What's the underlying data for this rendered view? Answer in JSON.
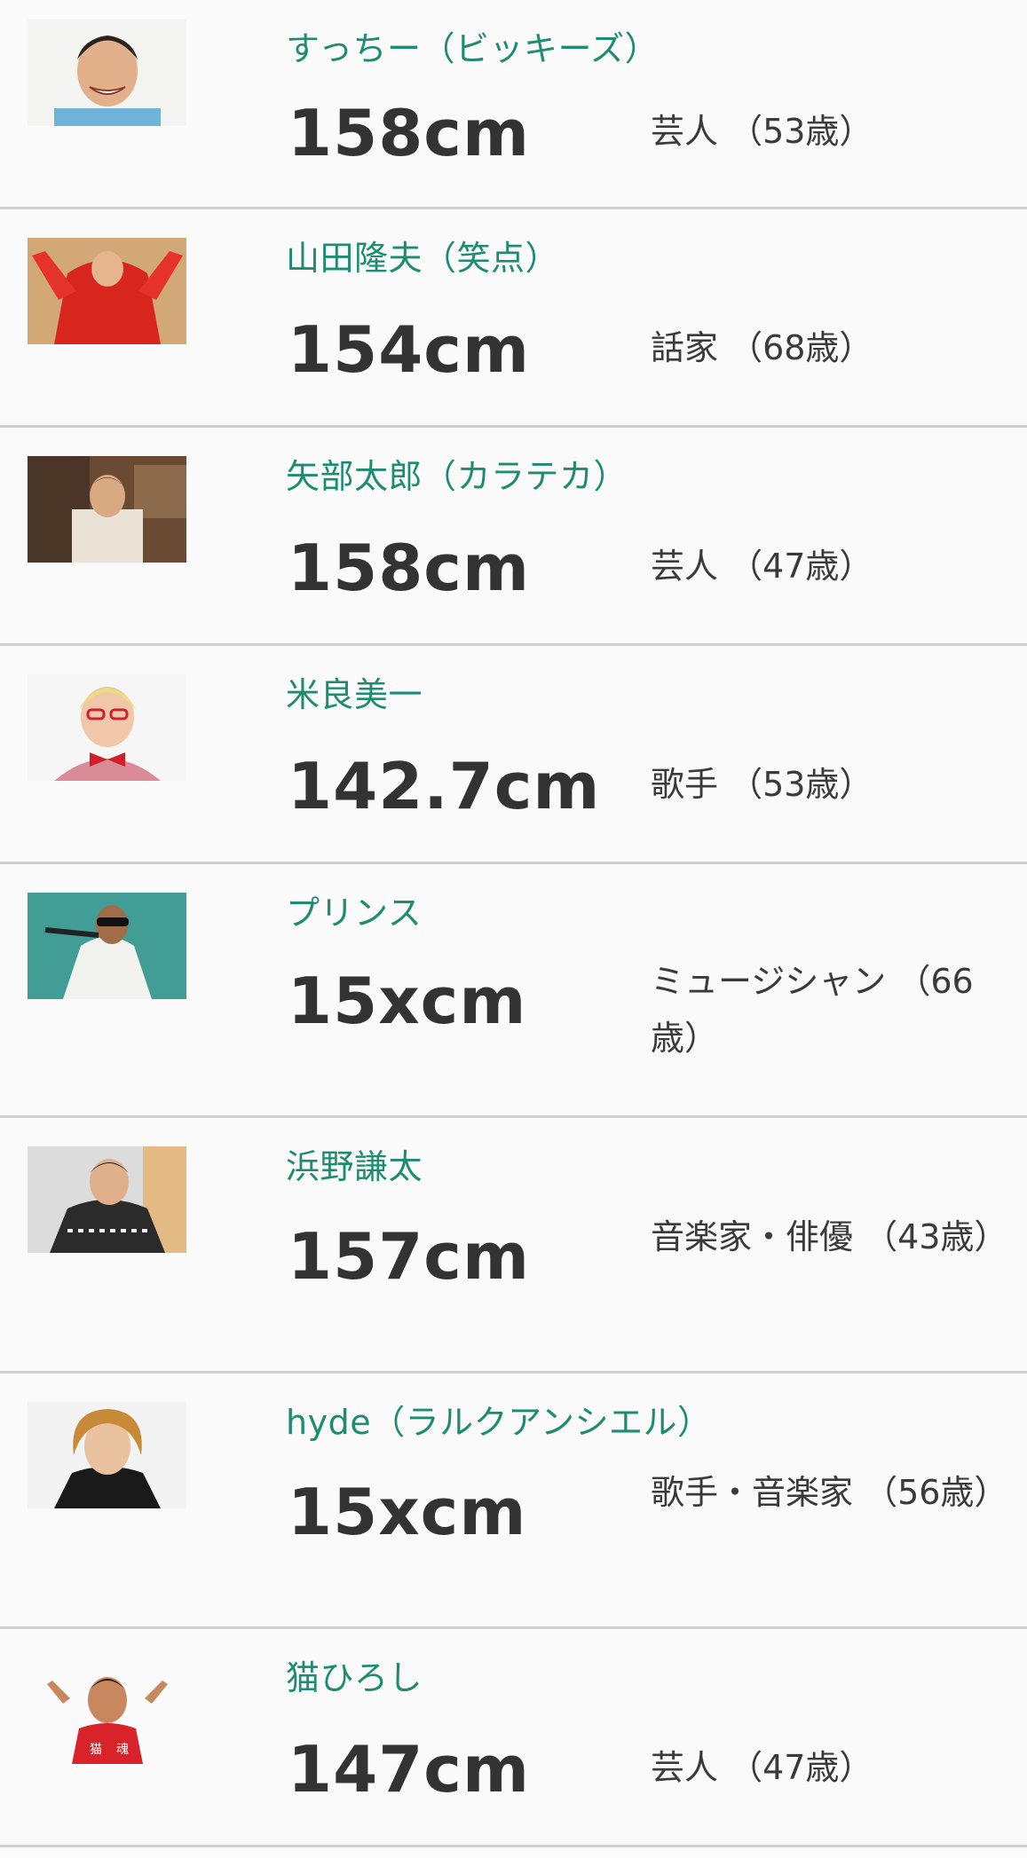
{
  "rows": [
    {
      "name": "すっちー（ビッキーズ）",
      "height": "158cm",
      "info": "芸人 （53歳）",
      "thumb": "comedian-photo"
    },
    {
      "name": "山田隆夫（笑点）",
      "height": "154cm",
      "info": "話家 （68歳）",
      "thumb": "rakugo-red-costume-photo"
    },
    {
      "name": "矢部太郎（カラテカ）",
      "height": "158cm",
      "info": "芸人 （47歳）",
      "thumb": "room-portrait-photo"
    },
    {
      "name": "米良美一",
      "height": "142.7cm",
      "info": "歌手 （53歳）",
      "thumb": "red-bowtie-photo"
    },
    {
      "name": "プリンス",
      "height": "15xcm",
      "info": "ミュージシャン （66歳）",
      "thumb": "microphone-singer-photo"
    },
    {
      "name": "浜野謙太",
      "height": "157cm",
      "info": "音楽家・俳優 （43歳）",
      "thumb": "checkered-shirt-photo"
    },
    {
      "name": "hyde（ラルクアンシエル）",
      "height": "15xcm",
      "info": "歌手・音楽家 （56歳）",
      "thumb": "blond-singer-photo"
    },
    {
      "name": "猫ひろし",
      "height": "147cm",
      "info": "芸人 （47歳）",
      "thumb": "hands-up-runner-photo"
    }
  ]
}
